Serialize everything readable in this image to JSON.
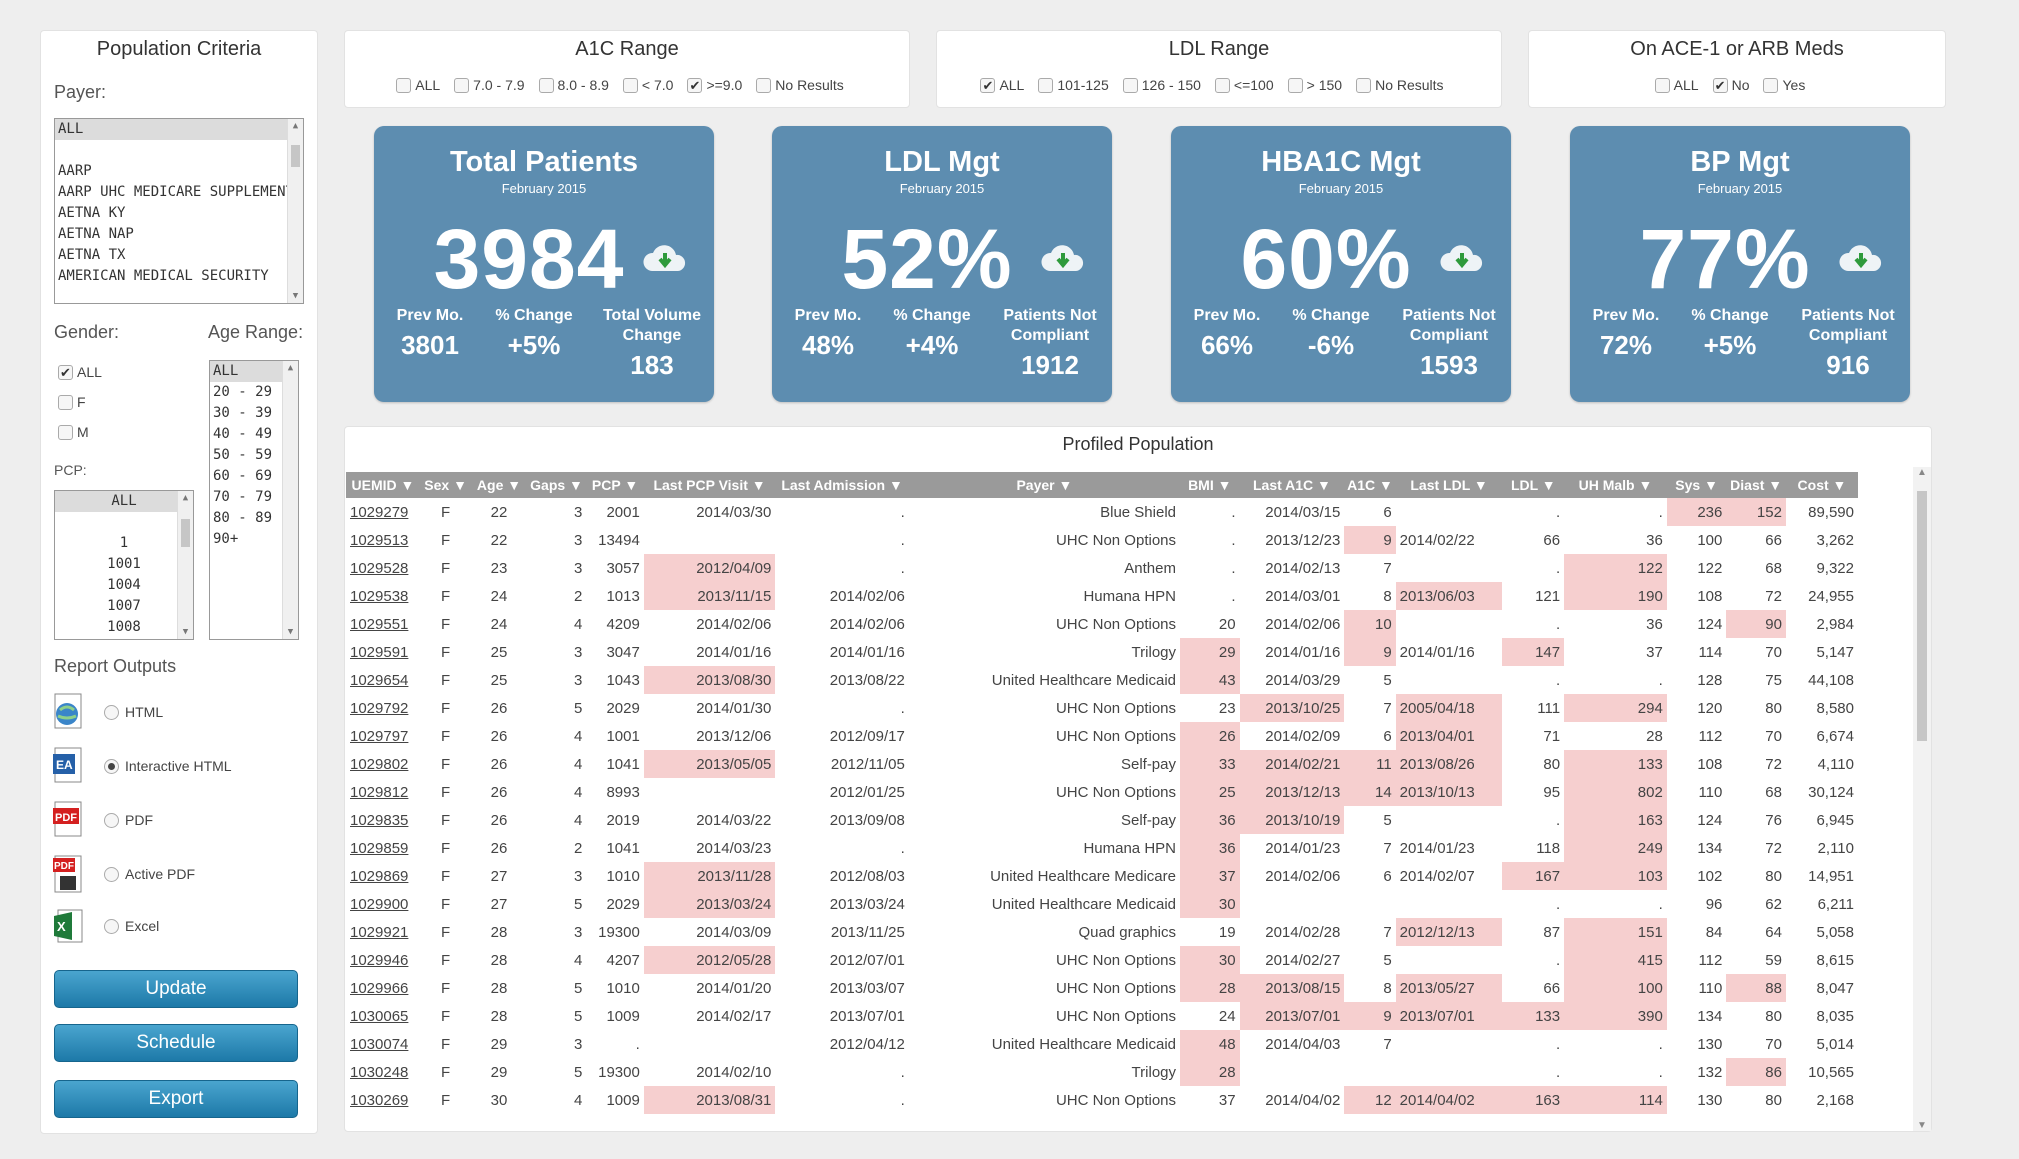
{
  "criteria": {
    "title": "Population Criteria",
    "payer_label": "Payer:",
    "payers": [
      "ALL",
      "",
      "AARP",
      "AARP UHC MEDICARE SUPPLEMENT",
      "AETNA KY",
      "AETNA NAP",
      "AETNA TX",
      "AMERICAN MEDICAL SECURITY"
    ],
    "gender_label": "Gender:",
    "genders": [
      {
        "label": "ALL",
        "checked": true
      },
      {
        "label": "F",
        "checked": false
      },
      {
        "label": "M",
        "checked": false
      }
    ],
    "age_label": "Age Range:",
    "ages": [
      "ALL",
      "20 - 29",
      "30 - 39",
      "40 - 49",
      "50 - 59",
      "60 - 69",
      "70 - 79",
      "80 - 89",
      "90+"
    ],
    "pcp_label": "PCP:",
    "pcps": [
      "ALL",
      "",
      "1",
      "1001",
      "1004",
      "1007",
      "1008"
    ],
    "report_outputs_label": "Report Outputs",
    "outputs": [
      {
        "label": "HTML",
        "icon": "html-globe-icon",
        "selected": false
      },
      {
        "label": "Interactive HTML",
        "icon": "interactive-html-icon",
        "selected": true
      },
      {
        "label": "PDF",
        "icon": "pdf-icon",
        "selected": false
      },
      {
        "label": "Active PDF",
        "icon": "active-pdf-icon",
        "selected": false
      },
      {
        "label": "Excel",
        "icon": "excel-icon",
        "selected": false
      }
    ],
    "buttons": {
      "update": "Update",
      "schedule": "Schedule",
      "export": "Export"
    }
  },
  "filters": {
    "a1c": {
      "title": "A1C Range",
      "options": [
        {
          "label": "ALL",
          "checked": false
        },
        {
          "label": "7.0 - 7.9",
          "checked": false
        },
        {
          "label": "8.0 - 8.9",
          "checked": false
        },
        {
          "label": "< 7.0",
          "checked": false
        },
        {
          "label": ">=9.0",
          "checked": true
        },
        {
          "label": "No Results",
          "checked": false
        }
      ]
    },
    "ldl": {
      "title": "LDL Range",
      "options": [
        {
          "label": "ALL",
          "checked": true
        },
        {
          "label": "101-125",
          "checked": false
        },
        {
          "label": "126 - 150",
          "checked": false
        },
        {
          "label": "<=100",
          "checked": false
        },
        {
          "label": "> 150",
          "checked": false
        },
        {
          "label": "No Results",
          "checked": false
        }
      ]
    },
    "ace": {
      "title": "On ACE-1 or ARB Meds",
      "options": [
        {
          "label": "ALL",
          "checked": false
        },
        {
          "label": "No",
          "checked": true
        },
        {
          "label": "Yes",
          "checked": false
        }
      ]
    }
  },
  "kpis": [
    {
      "title": "Total Patients",
      "sub": "February 2015",
      "value": "3984",
      "s1_label": "Prev Mo.",
      "s1": "3801",
      "s2_label": "% Change",
      "s2": "+5%",
      "s3_label": "Total Volume Change",
      "s3": "183"
    },
    {
      "title": "LDL Mgt",
      "sub": "February 2015",
      "value": "52%",
      "s1_label": "Prev Mo.",
      "s1": "48%",
      "s2_label": "% Change",
      "s2": "+4%",
      "s3_label": "Patients Not Compliant",
      "s3": "1912"
    },
    {
      "title": "HBA1C Mgt",
      "sub": "February 2015",
      "value": "60%",
      "s1_label": "Prev Mo.",
      "s1": "66%",
      "s2_label": "% Change",
      "s2": "-6%",
      "s3_label": "Patients Not Compliant",
      "s3": "1593"
    },
    {
      "title": "BP Mgt",
      "sub": "February 2015",
      "value": "77%",
      "s1_label": "Prev Mo.",
      "s1": "72%",
      "s2_label": "% Change",
      "s2": "+5%",
      "s3_label": "Patients Not Compliant",
      "s3": "916"
    }
  ],
  "profiled": {
    "title": "Profiled Population",
    "columns": [
      "UEMID",
      "Sex",
      "Age",
      "Gaps",
      "PCP",
      "Last PCP Visit",
      "Last Admission",
      "Payer",
      "BMI",
      "Last A1C",
      "A1C",
      "Last LDL",
      "LDL",
      "UH Malb",
      "Sys",
      "Diast",
      "Cost"
    ],
    "rows": [
      [
        "1029279",
        "F",
        "22",
        "3",
        "2001",
        "2014/03/30",
        ".",
        "Blue Shield",
        ".",
        "2014/03/15",
        "6",
        "",
        ".",
        ".",
        "236",
        "152",
        "89,590"
      ],
      [
        "1029513",
        "F",
        "22",
        "3",
        "13494",
        "",
        ".",
        "UHC Non Options",
        ".",
        "2013/12/23",
        "9",
        "2014/02/22",
        "66",
        "36",
        "100",
        "66",
        "3,262"
      ],
      [
        "1029528",
        "F",
        "23",
        "3",
        "3057",
        "2012/04/09",
        ".",
        "Anthem",
        ".",
        "2014/02/13",
        "7",
        "",
        ".",
        "122",
        "122",
        "68",
        "9,322"
      ],
      [
        "1029538",
        "F",
        "24",
        "2",
        "1013",
        "2013/11/15",
        "2014/02/06",
        "Humana HPN",
        ".",
        "2014/03/01",
        "8",
        "2013/06/03",
        "121",
        "190",
        "108",
        "72",
        "24,955"
      ],
      [
        "1029551",
        "F",
        "24",
        "4",
        "4209",
        "2014/02/06",
        "2014/02/06",
        "UHC Non Options",
        "20",
        "2014/02/06",
        "10",
        "",
        ".",
        "36",
        "124",
        "90",
        "2,984"
      ],
      [
        "1029591",
        "F",
        "25",
        "3",
        "3047",
        "2014/01/16",
        "2014/01/16",
        "Trilogy",
        "29",
        "2014/01/16",
        "9",
        "2014/01/16",
        "147",
        "37",
        "114",
        "70",
        "5,147"
      ],
      [
        "1029654",
        "F",
        "25",
        "3",
        "1043",
        "2013/08/30",
        "2013/08/22",
        "United Healthcare Medicaid",
        "43",
        "2014/03/29",
        "5",
        "",
        ".",
        ".",
        "128",
        "75",
        "44,108"
      ],
      [
        "1029792",
        "F",
        "26",
        "5",
        "2029",
        "2014/01/30",
        ".",
        "UHC Non Options",
        "23",
        "2013/10/25",
        "7",
        "2005/04/18",
        "111",
        "294",
        "120",
        "80",
        "8,580"
      ],
      [
        "1029797",
        "F",
        "26",
        "4",
        "1001",
        "2013/12/06",
        "2012/09/17",
        "UHC Non Options",
        "26",
        "2014/02/09",
        "6",
        "2013/04/01",
        "71",
        "28",
        "112",
        "70",
        "6,674"
      ],
      [
        "1029802",
        "F",
        "26",
        "4",
        "1041",
        "2013/05/05",
        "2012/11/05",
        "Self-pay",
        "33",
        "2014/02/21",
        "11",
        "2013/08/26",
        "80",
        "133",
        "108",
        "72",
        "4,110"
      ],
      [
        "1029812",
        "F",
        "26",
        "4",
        "8993",
        "",
        "2012/01/25",
        "UHC Non Options",
        "25",
        "2013/12/13",
        "14",
        "2013/10/13",
        "95",
        "802",
        "110",
        "68",
        "30,124"
      ],
      [
        "1029835",
        "F",
        "26",
        "4",
        "2019",
        "2014/03/22",
        "2013/09/08",
        "Self-pay",
        "36",
        "2013/10/19",
        "5",
        "",
        ".",
        "163",
        "124",
        "76",
        "6,945"
      ],
      [
        "1029859",
        "F",
        "26",
        "2",
        "1041",
        "2014/03/23",
        ".",
        "Humana HPN",
        "36",
        "2014/01/23",
        "7",
        "2014/01/23",
        "118",
        "249",
        "134",
        "72",
        "2,110"
      ],
      [
        "1029869",
        "F",
        "27",
        "3",
        "1010",
        "2013/11/28",
        "2012/08/03",
        "United Healthcare Medicare",
        "37",
        "2014/02/06",
        "6",
        "2014/02/07",
        "167",
        "103",
        "102",
        "80",
        "14,951"
      ],
      [
        "1029900",
        "F",
        "27",
        "5",
        "2029",
        "2013/03/24",
        "2013/03/24",
        "United Healthcare Medicaid",
        "30",
        "",
        "",
        "",
        ".",
        ".",
        "96",
        "62",
        "6,211"
      ],
      [
        "1029921",
        "F",
        "28",
        "3",
        "19300",
        "2014/03/09",
        "2013/11/25",
        "Quad graphics",
        "19",
        "2014/02/28",
        "7",
        "2012/12/13",
        "87",
        "151",
        "84",
        "64",
        "5,058"
      ],
      [
        "1029946",
        "F",
        "28",
        "4",
        "4207",
        "2012/05/28",
        "2012/07/01",
        "UHC Non Options",
        "30",
        "2014/02/27",
        "5",
        "",
        ".",
        "415",
        "112",
        "59",
        "8,615"
      ],
      [
        "1029966",
        "F",
        "28",
        "5",
        "1010",
        "2014/01/20",
        "2013/03/07",
        "UHC Non Options",
        "28",
        "2013/08/15",
        "8",
        "2013/05/27",
        "66",
        "100",
        "110",
        "88",
        "8,047"
      ],
      [
        "1030065",
        "F",
        "28",
        "5",
        "1009",
        "2014/02/17",
        "2013/07/01",
        "UHC Non Options",
        "24",
        "2013/07/01",
        "9",
        "2013/07/01",
        "133",
        "390",
        "134",
        "80",
        "8,035"
      ],
      [
        "1030074",
        "F",
        "29",
        "3",
        ".",
        "",
        "2012/04/12",
        "United Healthcare Medicaid",
        "48",
        "2014/04/03",
        "7",
        "",
        ".",
        ".",
        "130",
        "70",
        "5,014"
      ],
      [
        "1030248",
        "F",
        "29",
        "5",
        "19300",
        "2014/02/10",
        ".",
        "Trilogy",
        "28",
        "",
        "",
        "",
        ".",
        ".",
        "132",
        "86",
        "10,565"
      ],
      [
        "1030269",
        "F",
        "30",
        "4",
        "1009",
        "2013/08/31",
        ".",
        "UHC Non Options",
        "37",
        "2014/04/02",
        "12",
        "2014/04/02",
        "163",
        "114",
        "130",
        "80",
        "2,168"
      ]
    ],
    "highlights": [
      [
        0,
        14
      ],
      [
        0,
        15
      ],
      [
        1,
        10
      ],
      [
        2,
        5
      ],
      [
        2,
        13
      ],
      [
        3,
        5
      ],
      [
        3,
        11
      ],
      [
        3,
        13
      ],
      [
        4,
        10
      ],
      [
        4,
        15
      ],
      [
        5,
        8
      ],
      [
        5,
        10
      ],
      [
        5,
        12
      ],
      [
        6,
        5
      ],
      [
        6,
        8
      ],
      [
        7,
        9
      ],
      [
        7,
        11
      ],
      [
        7,
        13
      ],
      [
        8,
        8
      ],
      [
        8,
        11
      ],
      [
        9,
        5
      ],
      [
        9,
        8
      ],
      [
        9,
        9
      ],
      [
        9,
        10
      ],
      [
        9,
        11
      ],
      [
        9,
        13
      ],
      [
        10,
        8
      ],
      [
        10,
        9
      ],
      [
        10,
        10
      ],
      [
        10,
        11
      ],
      [
        10,
        13
      ],
      [
        11,
        8
      ],
      [
        11,
        9
      ],
      [
        11,
        13
      ],
      [
        12,
        8
      ],
      [
        12,
        13
      ],
      [
        13,
        5
      ],
      [
        13,
        8
      ],
      [
        13,
        12
      ],
      [
        13,
        13
      ],
      [
        14,
        5
      ],
      [
        14,
        8
      ],
      [
        15,
        11
      ],
      [
        15,
        13
      ],
      [
        16,
        5
      ],
      [
        16,
        8
      ],
      [
        16,
        13
      ],
      [
        17,
        8
      ],
      [
        17,
        9
      ],
      [
        17,
        11
      ],
      [
        17,
        13
      ],
      [
        17,
        15
      ],
      [
        18,
        9
      ],
      [
        18,
        10
      ],
      [
        18,
        11
      ],
      [
        18,
        12
      ],
      [
        18,
        13
      ],
      [
        19,
        8
      ],
      [
        20,
        8
      ],
      [
        20,
        15
      ],
      [
        21,
        5
      ],
      [
        21,
        10
      ],
      [
        21,
        11
      ],
      [
        21,
        12
      ],
      [
        21,
        13
      ]
    ]
  }
}
